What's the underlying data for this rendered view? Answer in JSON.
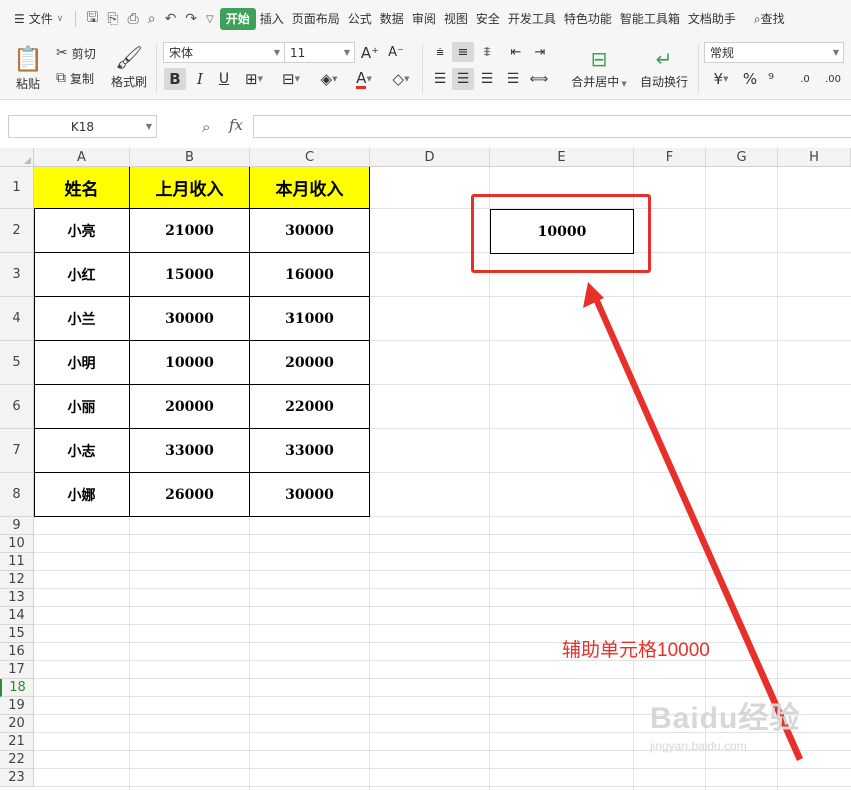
{
  "menubar": {
    "file_label": "文件",
    "tabs": [
      "开始",
      "插入",
      "页面布局",
      "公式",
      "数据",
      "审阅",
      "视图",
      "安全",
      "开发工具",
      "特色功能",
      "智能工具箱",
      "文档助手"
    ],
    "active_tab": "开始",
    "search_label": "查找"
  },
  "ribbon": {
    "paste": "粘贴",
    "cut": "剪切",
    "copy": "复制",
    "format_painter": "格式刷",
    "font_name": "宋体",
    "font_size": "11",
    "merge_center": "合并居中",
    "wrap_text": "自动换行",
    "number_format": "常规",
    "bold": "B",
    "italic": "I",
    "underline": "U"
  },
  "formula_bar": {
    "name_box": "K18",
    "fx": "fx",
    "formula": ""
  },
  "columns": [
    "A",
    "B",
    "C",
    "D",
    "E",
    "F",
    "G",
    "H"
  ],
  "rows": [
    "1",
    "2",
    "3",
    "4",
    "5",
    "6",
    "7",
    "8",
    "9",
    "10",
    "11",
    "12",
    "13",
    "14",
    "15",
    "16",
    "17",
    "18",
    "19",
    "20",
    "21",
    "22",
    "23"
  ],
  "active_row": "18",
  "table": {
    "headers": [
      "姓名",
      "上月收入",
      "本月收入"
    ],
    "rows": [
      [
        "小亮",
        "21000",
        "30000"
      ],
      [
        "小红",
        "15000",
        "16000"
      ],
      [
        "小兰",
        "30000",
        "31000"
      ],
      [
        "小明",
        "10000",
        "20000"
      ],
      [
        "小丽",
        "20000",
        "22000"
      ],
      [
        "小志",
        "33000",
        "33000"
      ],
      [
        "小娜",
        "26000",
        "30000"
      ]
    ]
  },
  "helper_cell": {
    "value": "10000"
  },
  "annotation": "辅助单元格10000",
  "watermark": {
    "main": "Baidu经验",
    "sub": "jingyan.baidu.com"
  },
  "colors": {
    "header_fill": "#ffff00",
    "annotation_red": "#e8302a",
    "active_green": "#3ea05a"
  }
}
